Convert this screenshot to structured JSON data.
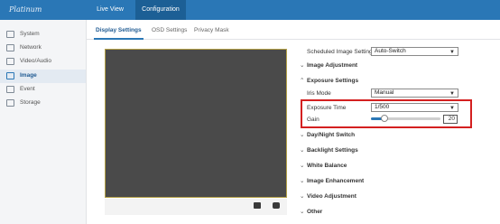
{
  "header": {
    "brand": "Platinum",
    "nav": [
      {
        "label": "Live View"
      },
      {
        "label": "Configuration"
      }
    ]
  },
  "sidebar": {
    "items": [
      {
        "label": "System",
        "icon": "system-icon"
      },
      {
        "label": "Network",
        "icon": "network-icon"
      },
      {
        "label": "Video/Audio",
        "icon": "video-audio-icon"
      },
      {
        "label": "Image",
        "icon": "image-icon"
      },
      {
        "label": "Event",
        "icon": "event-icon"
      },
      {
        "label": "Storage",
        "icon": "storage-icon"
      }
    ]
  },
  "tabs": [
    {
      "label": "Display Settings"
    },
    {
      "label": "OSD Settings"
    },
    {
      "label": "Privacy Mask"
    }
  ],
  "settings": {
    "scheduled_label": "Scheduled Image Settings",
    "scheduled_value": "Auto-Switch",
    "image_adjustment": "Image Adjustment",
    "exposure_settings": "Exposure Settings",
    "iris_label": "Iris Mode",
    "iris_value": "Manual",
    "exposure_time_label": "Exposure Time",
    "exposure_time_value": "1/500",
    "gain_label": "Gain",
    "gain_value": "20",
    "gain_level_fraction": 0.2,
    "sections": [
      {
        "label": "Day/Night Switch"
      },
      {
        "label": "Backlight Settings"
      },
      {
        "label": "White Balance"
      },
      {
        "label": "Image Enhancement"
      },
      {
        "label": "Video Adjustment"
      },
      {
        "label": "Other"
      }
    ]
  },
  "colors": {
    "topbar": "#2a77b6",
    "highlight": "#d42020"
  }
}
